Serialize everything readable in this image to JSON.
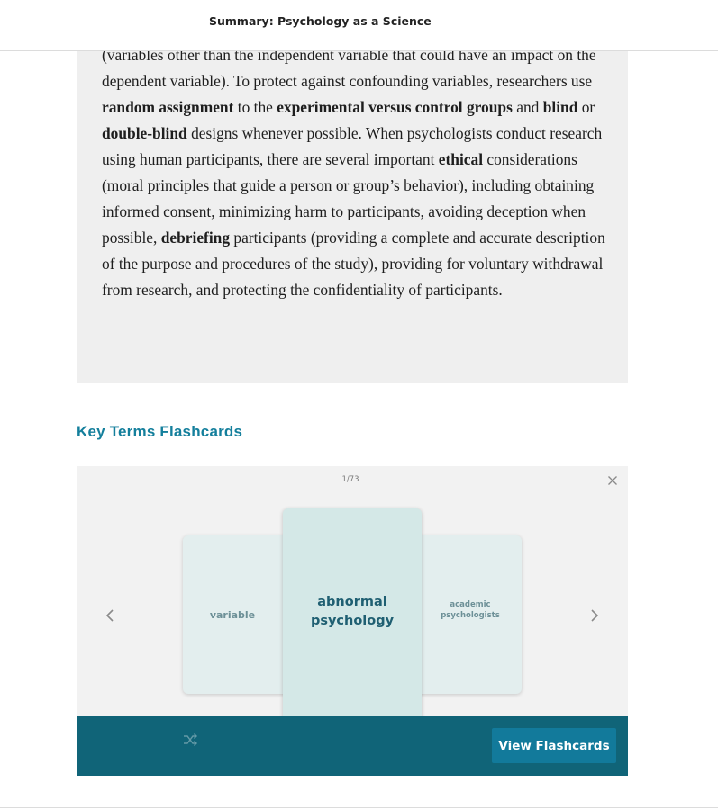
{
  "header": {
    "title": "Summary: Psychology as a Science"
  },
  "summary": {
    "segments": [
      {
        "text": "(variables other than the independent variable that could have an impact on the dependent variable). To protect against confounding variables, researchers use ",
        "bold": false
      },
      {
        "text": "random assignment",
        "bold": true
      },
      {
        "text": " to the ",
        "bold": false
      },
      {
        "text": "experimental versus control groups",
        "bold": true
      },
      {
        "text": " and ",
        "bold": false
      },
      {
        "text": "blind",
        "bold": true
      },
      {
        "text": " or ",
        "bold": false
      },
      {
        "text": "double-blind",
        "bold": true
      },
      {
        "text": " designs whenever possible. When psychologists conduct research using human participants, there are several important ",
        "bold": false
      },
      {
        "text": "ethical",
        "bold": true
      },
      {
        "text": "  considerations (moral principles that guide a person or group’s behavior), including obtaining informed consent, minimizing harm to participants, avoiding deception when possible, ",
        "bold": false
      },
      {
        "text": "debriefing",
        "bold": true
      },
      {
        "text": " participants (providing a complete and accurate description of the purpose and procedures of the study), providing for voluntary withdrawal from research, and protecting the confidentiality of participants.",
        "bold": false
      }
    ]
  },
  "flashcards": {
    "section_title": "Key Terms Flashcards",
    "counter": "1/73",
    "cards": {
      "left": "variable",
      "center": "abnormal psychology",
      "right": "academic psychologists"
    },
    "view_button_label": "View Flashcards",
    "icons": {
      "close": "close-icon",
      "prev": "chevron-left-icon",
      "next": "chevron-right-icon",
      "shuffle": "shuffle-icon"
    },
    "colors": {
      "accent": "#147f9c",
      "bar": "#106478",
      "button": "#127a9b",
      "card_center": "#d4e8e7",
      "card_side": "#e3eeee"
    }
  }
}
